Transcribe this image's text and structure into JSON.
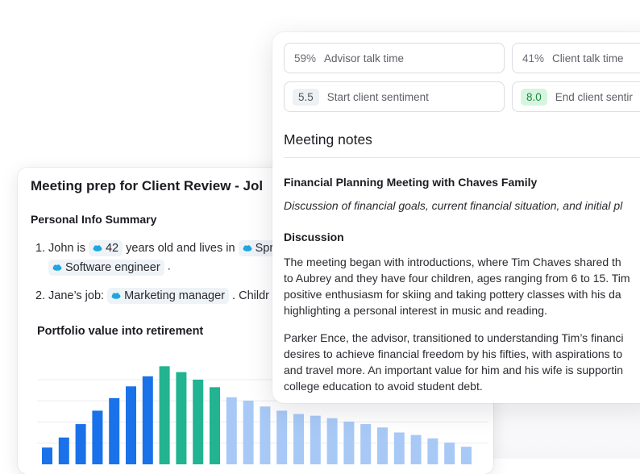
{
  "colors": {
    "bar_blue": "#1a72ea",
    "bar_teal": "#22b391",
    "bar_light": "#a8c9f6",
    "salesforce_cloud": "#1fa6de",
    "positive_green": "#1f8a3f"
  },
  "icons": [
    "salesforce-cloud-icon"
  ],
  "prep": {
    "title": "Meeting prep for Client Review - Jol",
    "section_title": "Personal Info Summary",
    "items": [
      {
        "number": "1.",
        "text_a": "John is",
        "chip_age": "42",
        "text_b": "years old and lives in",
        "chip_city": "Spr",
        "chip_job": "Software engineer",
        "text_c": "."
      },
      {
        "number": "2.",
        "text_a": "Jane’s job:",
        "chip_job": "Marketing manager",
        "text_b": ". Childr"
      }
    ],
    "chart_title": "Portfolio value into retirement"
  },
  "chart_data": {
    "type": "bar",
    "title": "Portfolio value into retirement",
    "categories": [],
    "values": [
      20,
      32,
      48,
      64,
      79,
      93,
      105,
      117,
      110,
      101,
      92,
      80,
      76,
      69,
      64,
      60,
      58,
      55,
      51,
      48,
      44,
      38,
      35,
      31,
      26,
      21
    ],
    "bar_colors": [
      "blue",
      "blue",
      "blue",
      "blue",
      "blue",
      "blue",
      "blue",
      "teal",
      "teal",
      "teal",
      "teal",
      "light",
      "light",
      "light",
      "light",
      "light",
      "light",
      "light",
      "light",
      "light",
      "light",
      "light",
      "light",
      "light",
      "light",
      "light"
    ],
    "ylim": [
      0,
      125
    ],
    "grid": true,
    "xlabel": "",
    "ylabel": ""
  },
  "metrics": [
    {
      "value": "59%",
      "label": "Advisor talk time"
    },
    {
      "value": "41%",
      "label": "Client talk time"
    },
    {
      "value": "5.5",
      "label": "Start client sentiment"
    },
    {
      "value": "8.0",
      "label": "End client sentir"
    }
  ],
  "notes": {
    "heading": "Meeting notes",
    "title": "Financial Planning Meeting with Chaves Family",
    "description": "Discussion of financial goals, current financial situation, and initial pl",
    "section": "Discussion",
    "para1": [
      "The meeting began with introductions, where Tim Chaves shared th",
      "to Aubrey and they have four children, ages ranging from 6 to 15. Tim",
      "positive enthusiasm for skiing and taking pottery classes with his da",
      "highlighting a personal interest in music and reading."
    ],
    "para2": [
      "Parker Ence, the advisor, transitioned to understanding Tim’s financi",
      "desires to achieve financial freedom by his fifties, with aspirations to",
      "and travel more. An important value for him and his wife is supportin",
      "college education to avoid student debt."
    ]
  }
}
